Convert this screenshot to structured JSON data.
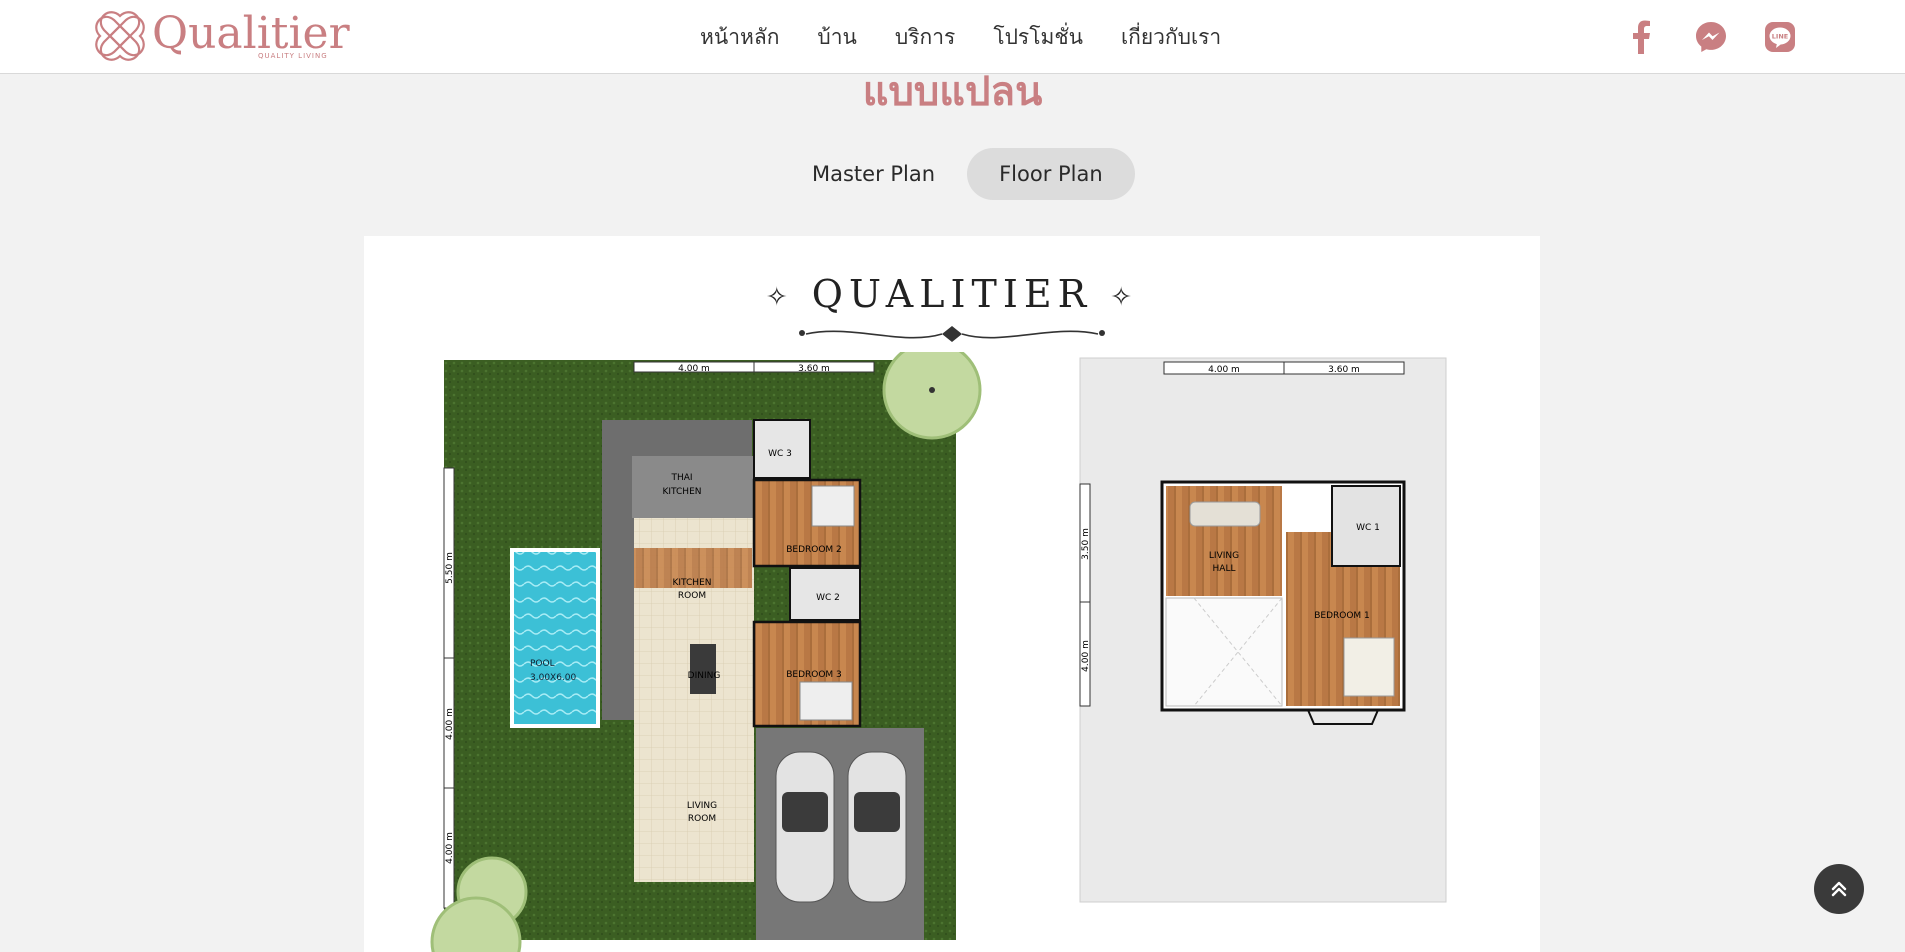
{
  "brand": {
    "logo_text": "Qualitier",
    "logo_sub": "QUALITY   LIVING",
    "accent": "#c97f82"
  },
  "nav": {
    "items": [
      "หน้าหลัก",
      "บ้าน",
      "บริการ",
      "โปรโมชั่น",
      "เกี่ยวกับเรา"
    ]
  },
  "social": {
    "icons": [
      "facebook-icon",
      "messenger-icon",
      "line-icon"
    ],
    "line_label": "LINE"
  },
  "page": {
    "title": "แบบแปลน",
    "tabs": [
      {
        "label": "Master Plan",
        "active": false
      },
      {
        "label": "Floor Plan",
        "active": true
      }
    ]
  },
  "plan": {
    "brand_title": "QUALITIER",
    "ground_floor": {
      "dim_top": [
        "4.00 m",
        "3.60 m"
      ],
      "dim_left": [
        "5.50 m",
        "4.00 m",
        "4.00 m"
      ],
      "rooms": {
        "thai_kitchen": [
          "THAI",
          "KITCHEN"
        ],
        "wc3": "WC 3",
        "bedroom2": "BEDROOM 2",
        "kitchen": [
          "KITCHEN",
          "ROOM"
        ],
        "wc2": "WC 2",
        "pool": [
          "POOL",
          "3.00X6.00"
        ],
        "dining": "DINING",
        "bedroom3": "BEDROOM 3",
        "living": [
          "LIVING",
          "ROOM"
        ]
      }
    },
    "upper_floor": {
      "dim_top": [
        "4.00 m",
        "3.60 m"
      ],
      "dim_left": [
        "3.50 m",
        "4.00 m"
      ],
      "rooms": {
        "living_hall": [
          "LIVING",
          "HALL"
        ],
        "wc1": "WC 1",
        "bedroom1": "BEDROOM 1"
      }
    }
  },
  "scroll_top": {
    "icon": "chevrons-up-icon"
  }
}
